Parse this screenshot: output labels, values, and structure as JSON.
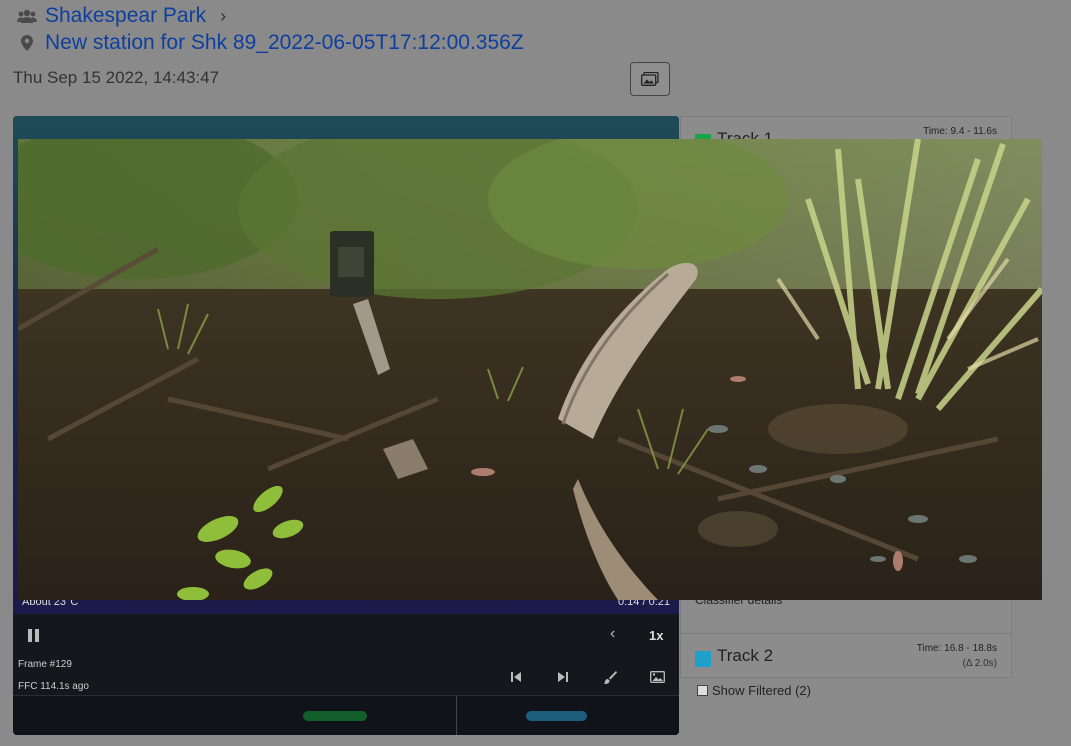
{
  "breadcrumb": {
    "group": "Shakespear Park",
    "station": "New station for Shk 89_2022-06-05T17:12:00.356Z"
  },
  "recording_datetime": "Thu Sep 15 2022, 14:43:47",
  "player": {
    "temperature": "About 23°C",
    "time_readout": "0:14 / 0:21",
    "speed": "1x",
    "frame": "Frame #129",
    "ffc": "FFC 114.1s ago",
    "progress_fraction": 0.667
  },
  "tracks": [
    {
      "label": "Track 1",
      "time": "Time: 9.4 - 11.6s",
      "color": "#16a34a"
    },
    {
      "label": "Track 2",
      "time": "Time: 16.8 - 18.8s",
      "delta": "(Δ 2.0s)",
      "color": "#1ea0c8"
    }
  ],
  "classifier_label": "Classifier details",
  "show_filtered": "Show Filtered (2)",
  "icons": {
    "group": "users-icon",
    "station": "map-marker-icon",
    "gallery": "images-icon"
  }
}
